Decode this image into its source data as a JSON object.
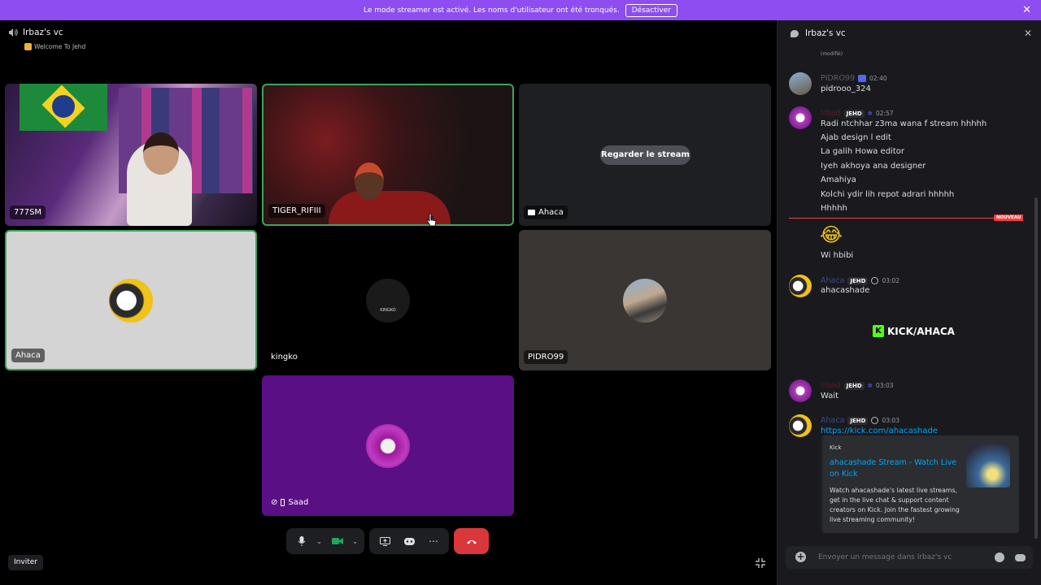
{
  "banner": {
    "text": "Le mode streamer est activé. Les noms d'utilisateur ont été tronqués.",
    "button": "Désactiver"
  },
  "voice": {
    "channel": "Irbaz's vc",
    "status": "Welcome To Jehd"
  },
  "tiles": {
    "t1": {
      "name": "777SM"
    },
    "t2": {
      "name": "TIGER_RIFIII"
    },
    "t3": {
      "name": "Аhаса",
      "watch": "Regarder le stream"
    },
    "t4": {
      "name": "Аhаса"
    },
    "t5": {
      "name": "kingko",
      "logo": "KINGKO"
    },
    "t6": {
      "name": "PIDRO99"
    },
    "t7": {
      "name": "Saad"
    }
  },
  "controls": {
    "invite": "Inviter"
  },
  "chat": {
    "title": "Irbaz's vc",
    "edited": "(modifié)",
    "m1": {
      "user": "PIDRO99",
      "time": "02:40",
      "lines": [
        "pidrooo_324"
      ]
    },
    "m2": {
      "user": "Irbad",
      "tag": "JEHD",
      "time": "02:57",
      "lines": [
        "Radi ntchhar z3ma wana f stream hhhhh",
        "Ajab design l edit",
        "La galih Howa editor",
        "Iyeh akhoya ana designer",
        "Amahiya",
        "Kolchi ydir lih repot adrari hhhhh",
        "Hhhhh"
      ]
    },
    "new_label": "NOUVEAU",
    "m2b": {
      "emoji": "😂",
      "line": "Wi hbibi"
    },
    "m3": {
      "user": "Аhаса",
      "tag": "JEHD",
      "time": "03:02",
      "line": "ahacashade",
      "image_text": "KICK/AHACA"
    },
    "m4": {
      "user": "Irbad",
      "tag": "JEHD",
      "time": "03:03",
      "line": "Wait"
    },
    "m5": {
      "user": "Аhаса",
      "tag": "JEHD",
      "time": "03:03",
      "link": "https://kick.com/ahacashade",
      "embed": {
        "provider": "Kick",
        "title": "ahacashade Stream - Watch Live on Kick",
        "desc": "Watch ahacashade's latest live streams, get in the live chat & support content creators on Kick. Join the fastest growing live streaming community!"
      }
    },
    "placeholder": "Envoyer un message dans Irbaz's vc"
  },
  "colors": {
    "accent": "#8d4df0",
    "hangup": "#da373c",
    "link": "#00a8fc",
    "new": "#f23f43"
  }
}
